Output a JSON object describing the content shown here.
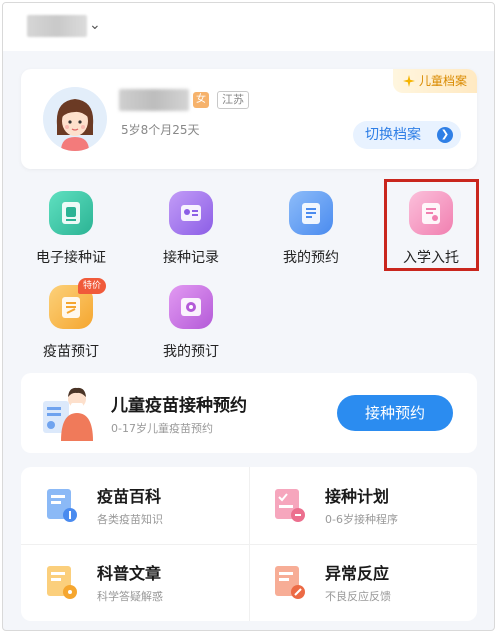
{
  "header": {
    "location_chevron": "⌄"
  },
  "profile": {
    "archive_tag": "儿童档案",
    "gender_badge": "女",
    "region": "江苏",
    "age": "5岁8个月25天",
    "switch_label": "切换档案",
    "switch_arrow": "❯"
  },
  "functions": [
    {
      "label": "电子接种证",
      "icon": "vaccine-card-icon",
      "color": "#3ec7a8"
    },
    {
      "label": "接种记录",
      "icon": "record-icon",
      "color": "#a77cf0"
    },
    {
      "label": "我的预约",
      "icon": "appointment-icon",
      "color": "#5a9cf5"
    },
    {
      "label": "入学入托",
      "icon": "school-entry-icon",
      "color": "#f59ec4"
    },
    {
      "label": "疫苗预订",
      "icon": "vaccine-order-icon",
      "color": "#f7b548",
      "badge": "特价"
    },
    {
      "label": "我的预订",
      "icon": "my-order-icon",
      "color": "#c76fe3"
    }
  ],
  "booking": {
    "title": "儿童疫苗接种预约",
    "subtitle": "0-17岁儿童疫苗预约",
    "button": "接种预约"
  },
  "info": [
    {
      "title": "疫苗百科",
      "subtitle": "各类疫苗知识",
      "icon": "vaccine-wiki-icon",
      "color": "#5a9cf5"
    },
    {
      "title": "接种计划",
      "subtitle": "0-6岁接种程序",
      "icon": "plan-icon",
      "color": "#f07fa0"
    },
    {
      "title": "科普文章",
      "subtitle": "科学答疑解惑",
      "icon": "article-icon",
      "color": "#f7b548"
    },
    {
      "title": "异常反应",
      "subtitle": "不良反应反馈",
      "icon": "reaction-icon",
      "color": "#f08a6a"
    }
  ]
}
